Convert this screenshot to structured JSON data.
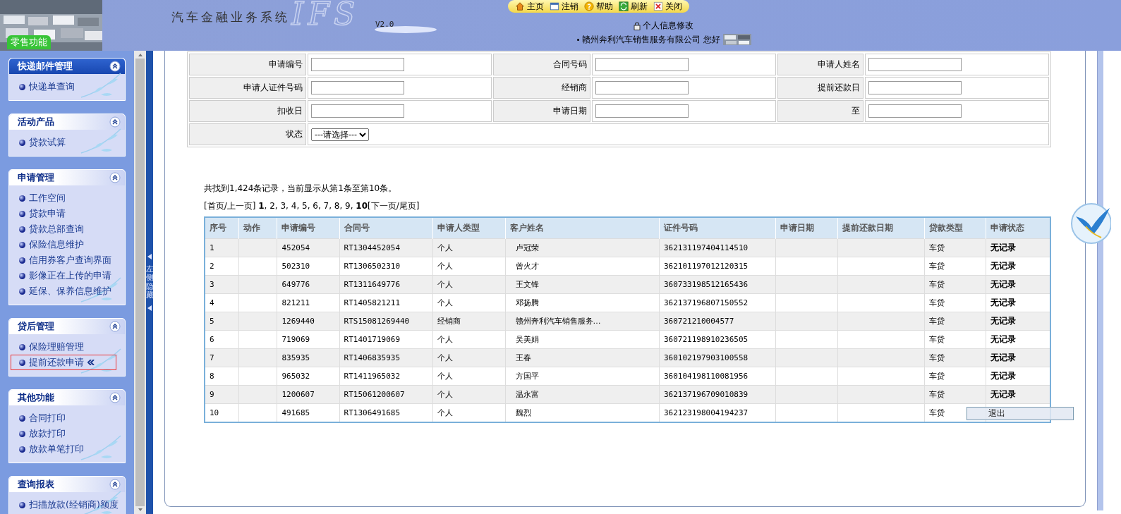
{
  "header": {
    "title": "汽车金融业务系统",
    "logo_mark": "IFS",
    "version": "V2.0",
    "module_tab": "零售功能",
    "toolbar": [
      {
        "label": "主页",
        "kind": "home"
      },
      {
        "label": "注销",
        "kind": "logout"
      },
      {
        "label": "帮助",
        "kind": "help"
      },
      {
        "label": "刷新",
        "kind": "refresh"
      },
      {
        "label": "关闭",
        "kind": "close"
      }
    ],
    "profile_link": "个人信息修改",
    "company": "赣州奔利汽车销售服务有限公司",
    "greeting": "您好"
  },
  "sidebar": {
    "sections": [
      {
        "title": "快递邮件管理",
        "selected": true,
        "items": [
          {
            "label": "快递单查询",
            "selected": false
          }
        ]
      },
      {
        "title": "活动产品",
        "selected": false,
        "items": [
          {
            "label": "贷款试算",
            "selected": false
          }
        ]
      },
      {
        "title": "申请管理",
        "selected": false,
        "items": [
          {
            "label": "工作空间",
            "selected": false
          },
          {
            "label": "贷款申请",
            "selected": false
          },
          {
            "label": "贷款总部查询",
            "selected": false
          },
          {
            "label": "保险信息维护",
            "selected": false
          },
          {
            "label": "信用券客户查询界面",
            "selected": false
          },
          {
            "label": "影像正在上传的申请",
            "selected": false
          },
          {
            "label": "延保、保养信息维护",
            "selected": false
          }
        ]
      },
      {
        "title": "贷后管理",
        "selected": false,
        "items": [
          {
            "label": "保险理赔管理",
            "selected": false
          },
          {
            "label": "提前还款申请",
            "selected": true
          }
        ]
      },
      {
        "title": "其他功能",
        "selected": false,
        "items": [
          {
            "label": "合同打印",
            "selected": false
          },
          {
            "label": "放款打印",
            "selected": false
          },
          {
            "label": "放款单笔打印",
            "selected": false
          }
        ]
      },
      {
        "title": "查询报表",
        "selected": false,
        "items": [
          {
            "label": "扫描放款(经销商)额度",
            "selected": false
          }
        ]
      }
    ]
  },
  "splitter": {
    "label": "左侧隐藏"
  },
  "search_form": {
    "fields": [
      {
        "label": "申请编号",
        "kind": "text"
      },
      {
        "label": "合同号码",
        "kind": "text"
      },
      {
        "label": "申请人姓名",
        "kind": "text"
      },
      {
        "label": "申请人证件号码",
        "kind": "text"
      },
      {
        "label": "经销商",
        "kind": "text"
      },
      {
        "label": "提前还款日",
        "kind": "text"
      },
      {
        "label": "扣收日",
        "kind": "text"
      },
      {
        "label": "申请日期",
        "kind": "text"
      },
      {
        "label": "至",
        "kind": "text"
      },
      {
        "label": "状态",
        "kind": "select",
        "value": "---请选择---"
      }
    ]
  },
  "results": {
    "summary": "共找到1,424条记录，当前显示从第1条至第10条。",
    "pager": "[首页/上一页] **1**, 2, 3, 4, 5, 6, 7, 8, 9, **10**[下一页/尾页]",
    "columns": [
      "序号",
      "动作",
      "申请编号",
      "合同号",
      "申请人类型",
      "客户姓名",
      "证件号码",
      "申请日期",
      "提前还款日期",
      "贷款类型",
      "申请状态"
    ],
    "rows": [
      {
        "no": "1",
        "app_no": "452054",
        "contract_no": "RT1304452054",
        "applicant_type": "个人",
        "customer_name": "卢冠荣",
        "id_no": "362131197404114510",
        "loan_type": "车贷",
        "status": "无记录"
      },
      {
        "no": "2",
        "app_no": "502310",
        "contract_no": "RT1306502310",
        "applicant_type": "个人",
        "customer_name": "曾火才",
        "id_no": "362101197012120315",
        "loan_type": "车贷",
        "status": "无记录"
      },
      {
        "no": "3",
        "app_no": "649776",
        "contract_no": "RT1311649776",
        "applicant_type": "个人",
        "customer_name": "王文锋",
        "id_no": "360733198512165436",
        "loan_type": "车贷",
        "status": "无记录"
      },
      {
        "no": "4",
        "app_no": "821211",
        "contract_no": "RT1405821211",
        "applicant_type": "个人",
        "customer_name": "邓扬腾",
        "id_no": "362137196807150552",
        "loan_type": "车贷",
        "status": "无记录"
      },
      {
        "no": "5",
        "app_no": "1269440",
        "contract_no": "RTS15081269440",
        "applicant_type": "经销商",
        "customer_name": "赣州奔利汽车销售服务…",
        "id_no": "360721210004577",
        "loan_type": "车贷",
        "status": "无记录"
      },
      {
        "no": "6",
        "app_no": "719069",
        "contract_no": "RT1401719069",
        "applicant_type": "个人",
        "customer_name": "吴美娟",
        "id_no": "360721198910236505",
        "loan_type": "车贷",
        "status": "无记录"
      },
      {
        "no": "7",
        "app_no": "835935",
        "contract_no": "RT1406835935",
        "applicant_type": "个人",
        "customer_name": "王春",
        "id_no": "360102197903100558",
        "loan_type": "车贷",
        "status": "无记录"
      },
      {
        "no": "8",
        "app_no": "965032",
        "contract_no": "RT1411965032",
        "applicant_type": "个人",
        "customer_name": "方国平",
        "id_no": "360104198110081956",
        "loan_type": "车贷",
        "status": "无记录"
      },
      {
        "no": "9",
        "app_no": "1200607",
        "contract_no": "RT15061200607",
        "applicant_type": "个人",
        "customer_name": "温永富",
        "id_no": "362137196709010839",
        "loan_type": "车贷",
        "status": "无记录"
      },
      {
        "no": "10",
        "app_no": "491685",
        "contract_no": "RT1306491685",
        "applicant_type": "个人",
        "customer_name": "魏烈",
        "id_no": "362123198004194237",
        "loan_type": "车贷"
      }
    ]
  },
  "popup": {
    "label": "退出"
  }
}
